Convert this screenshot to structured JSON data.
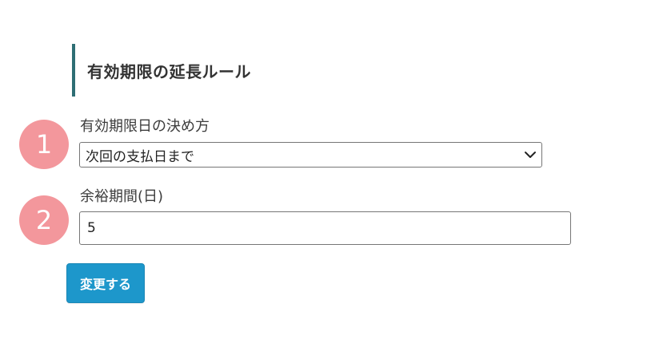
{
  "section": {
    "title": "有効期限の延長ルール"
  },
  "steps": [
    {
      "number": "1"
    },
    {
      "number": "2"
    }
  ],
  "form": {
    "expiry_method": {
      "label": "有効期限日の決め方",
      "selected_value": "次回の支払日まで",
      "icon": "chevron-down-icon"
    },
    "grace_period": {
      "label": "余裕期間(日)",
      "value": "5"
    },
    "submit_label": "変更する"
  },
  "colors": {
    "heading_border": "#2e6e74",
    "step_badge": "#f3979c",
    "button_bg": "#1d97cb",
    "button_text": "#ffffff"
  }
}
